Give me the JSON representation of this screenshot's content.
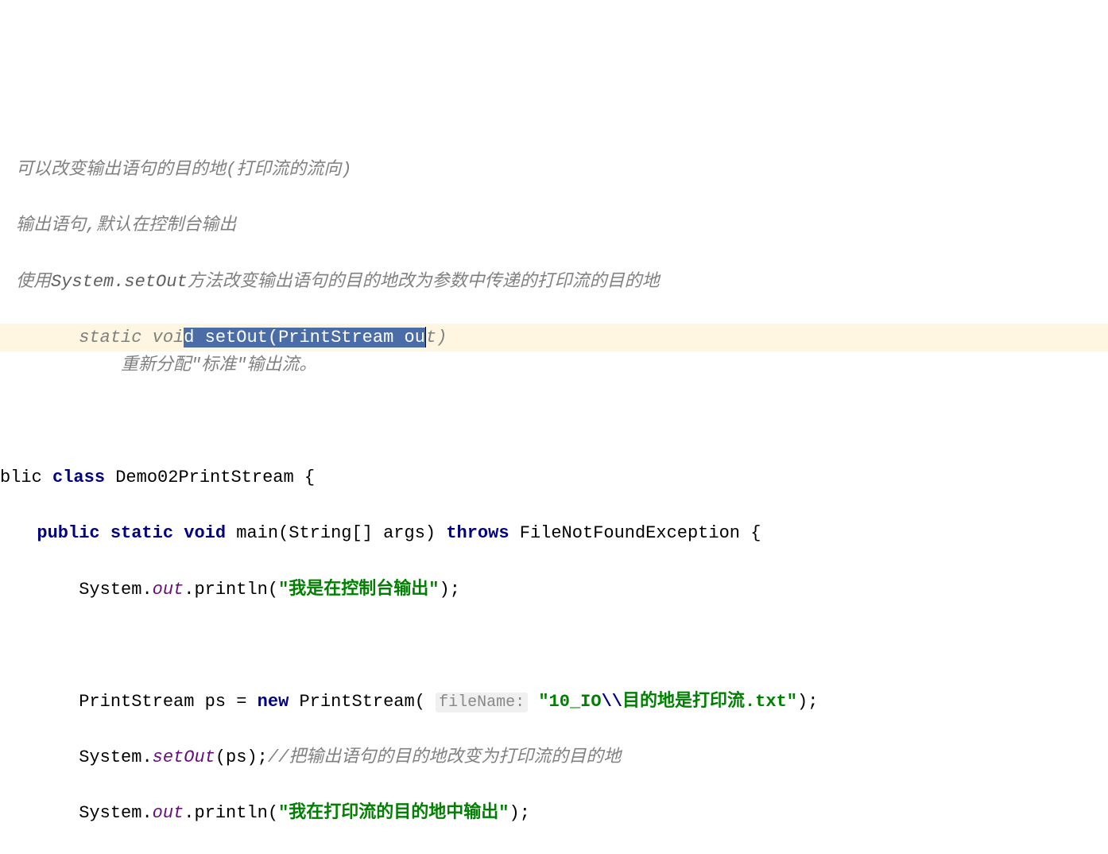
{
  "comments": {
    "line1": "可以改变输出语句的目的地(打印流的流向)",
    "line2": "输出语句,默认在控制台输出",
    "line3_prefix": "使用",
    "line3_code": "System.setOut",
    "line3_suffix": "方法改变输出语句的目的地改为参数中传递的打印流的目的地",
    "signature_prefix": "static voi",
    "signature_selected": "d setOut(PrintStream ou",
    "signature_suffix": "t)",
    "signature_desc": "重新分配\"标准\"输出流。"
  },
  "code": {
    "class_decl_prefix": "blic",
    "class_keyword": "class",
    "class_name": "Demo02PrintStream",
    "open_brace": "{",
    "public": "public",
    "static": "static",
    "void": "void",
    "main": "main",
    "main_params": "(String[] args)",
    "throws": "throws",
    "exception": "FileNotFoundException",
    "system": "System",
    "out": "out",
    "println": "println",
    "string1": "\"我是在控制台输出\"",
    "ps_type": "PrintStream",
    "ps_var": "ps",
    "equals": "=",
    "new": "new",
    "ps_ctor": "PrintStream",
    "param_hint": "fileName:",
    "string2_prefix": "\"10_IO",
    "string2_escape": "\\\\",
    "string2_suffix": "目的地是打印流.txt\"",
    "setOut": "setOut",
    "setOut_arg": "(ps)",
    "setOut_comment": "//把输出语句的目的地改变为打印流的目的地",
    "string3": "\"我在打印流的目的地中输出\"",
    "semicolon": ";",
    "close_paren": ")"
  }
}
